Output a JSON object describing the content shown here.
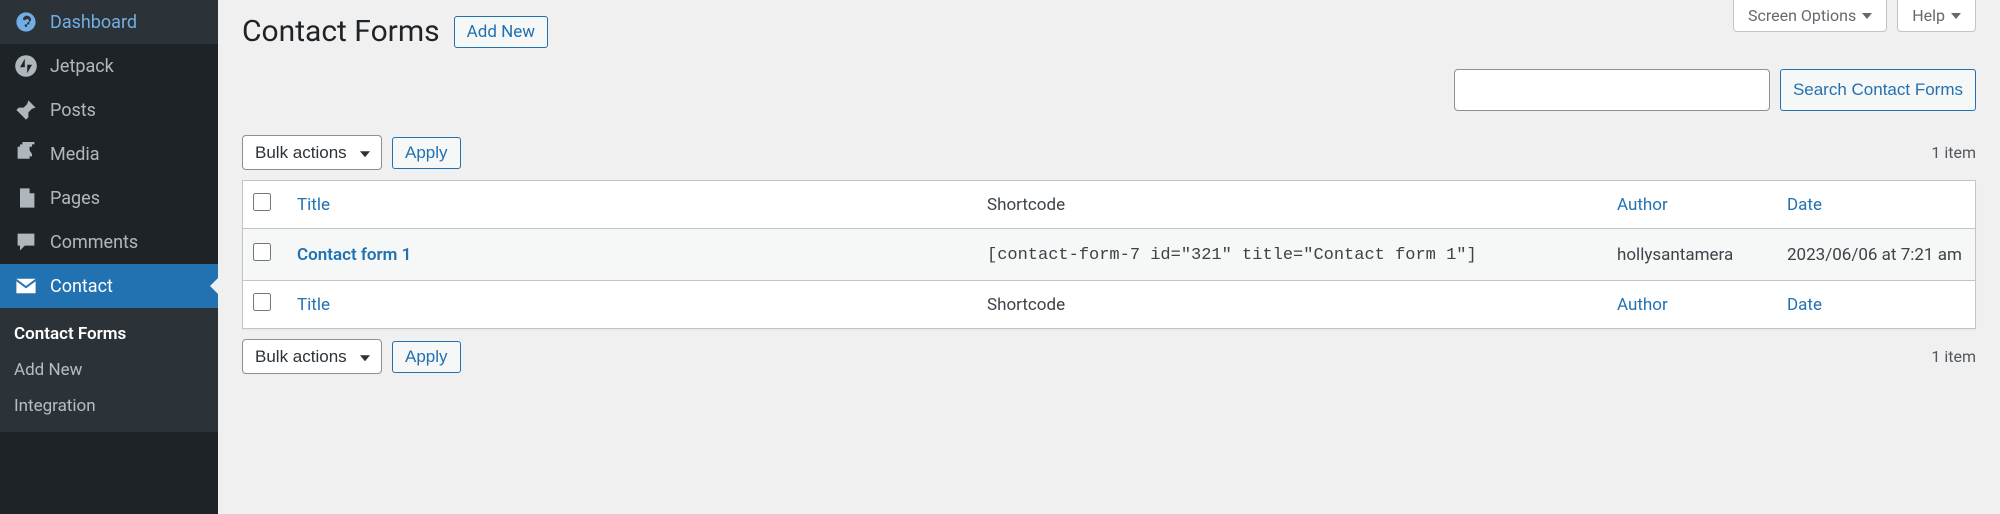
{
  "top_tabs": {
    "screen_options": "Screen Options",
    "help": "Help"
  },
  "sidebar": {
    "items": [
      {
        "label": "Dashboard",
        "icon": "dashboard"
      },
      {
        "label": "Jetpack",
        "icon": "jetpack"
      },
      {
        "label": "Posts",
        "icon": "pin"
      },
      {
        "label": "Media",
        "icon": "media"
      },
      {
        "label": "Pages",
        "icon": "pages"
      },
      {
        "label": "Comments",
        "icon": "comment"
      },
      {
        "label": "Contact",
        "icon": "mail",
        "active": true
      }
    ],
    "submenu": [
      {
        "label": "Contact Forms",
        "current": true
      },
      {
        "label": "Add New"
      },
      {
        "label": "Integration"
      }
    ]
  },
  "page": {
    "title": "Contact Forms",
    "add_new": "Add New"
  },
  "search": {
    "button": "Search Contact Forms",
    "value": ""
  },
  "bulk": {
    "label": "Bulk actions",
    "apply": "Apply"
  },
  "table": {
    "items_count": "1 item",
    "columns": {
      "title": "Title",
      "shortcode": "Shortcode",
      "author": "Author",
      "date": "Date"
    },
    "rows": [
      {
        "title": "Contact form 1",
        "shortcode": "[contact-form-7 id=\"321\" title=\"Contact form 1\"]",
        "author": "hollysantamera",
        "date": "2023/06/06 at 7:21 am"
      }
    ]
  }
}
